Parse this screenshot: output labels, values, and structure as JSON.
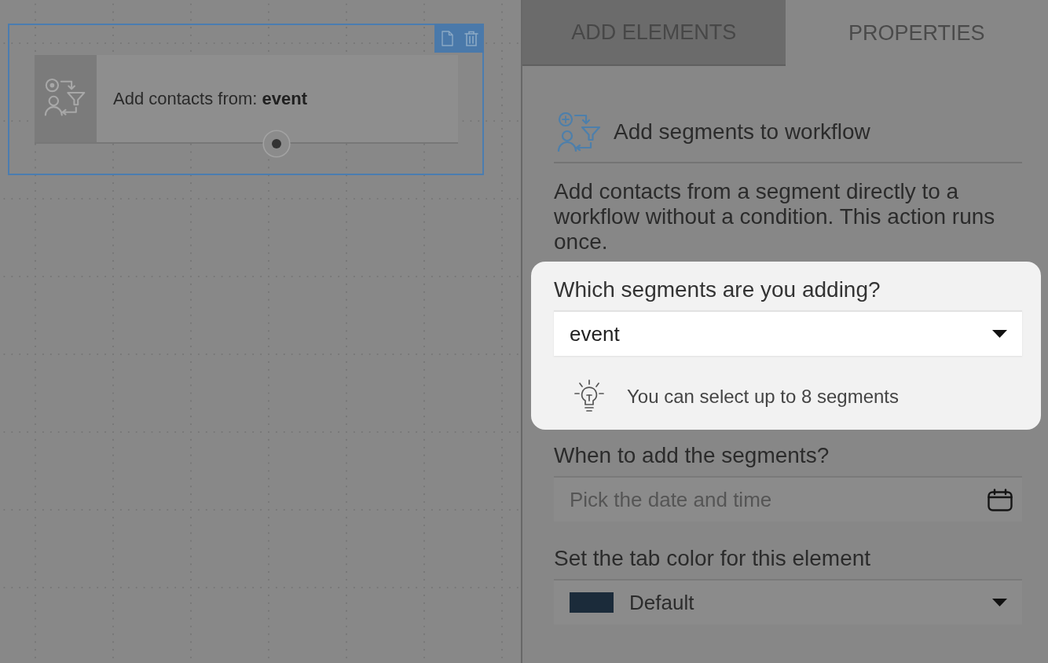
{
  "canvas": {
    "node": {
      "selected": true,
      "label": "Add contacts from: **event**"
    }
  },
  "panel": {
    "tabs": [
      {
        "label": "ADD ELEMENTS",
        "selected": false
      },
      {
        "label": "PROPERTIES",
        "selected": true
      }
    ],
    "header": {
      "title": "Add segments to workflow"
    },
    "description": "Add contacts from a segment directly to a workflow without a condition. This action runs once.",
    "fields": [
      {
        "kind": "select",
        "label": "Which segments are you adding?",
        "value": "event",
        "hint": "You can select up to 8 segments",
        "highlighted": true
      },
      {
        "kind": "datetime",
        "label": "When to add the segments?",
        "placeholder": "Pick the date and time",
        "highlighted": false
      },
      {
        "kind": "color_select",
        "label": "Set the tab color for this element",
        "value": "Default",
        "color": "#1b2b3a",
        "highlighted": false
      }
    ]
  }
}
